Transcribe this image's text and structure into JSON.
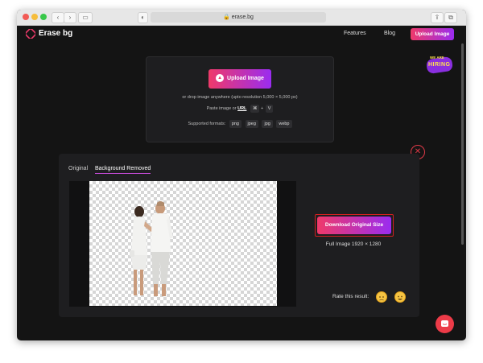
{
  "browser": {
    "url": "erase.bg",
    "back_icon": "chevron-left",
    "forward_icon": "chevron-right"
  },
  "nav": {
    "brand": "Erase bg",
    "links": [
      "Features",
      "Blog"
    ],
    "cta": "Upload Image",
    "hiring_badge_top": "WE ARE",
    "hiring_badge": "HIRING"
  },
  "upload": {
    "button": "Upload Image",
    "drop_text": "or drop image anywhere (upto resolution 5,000 × 5,000 px)",
    "paste_prefix": "Paste image or",
    "paste_url": "URL",
    "key_cmd": "⌘",
    "key_plus": "+",
    "key_v": "V",
    "formats_label": "Supported formats:",
    "formats": [
      "png",
      "jpeg",
      "jpg",
      "webp"
    ]
  },
  "result": {
    "tabs": [
      "Original",
      "Background Removed"
    ],
    "active_tab": "Background Removed",
    "download_label": "Download Original Size",
    "full_image_label": "Full Image",
    "full_image_size": "1920 × 1280",
    "rate_label": "Rate this result:"
  },
  "colors": {
    "accent_start": "#ef3a6a",
    "accent_end": "#9a2cf0",
    "download_border": "#d02020",
    "background": "#141414",
    "panel": "#1e1e20"
  }
}
